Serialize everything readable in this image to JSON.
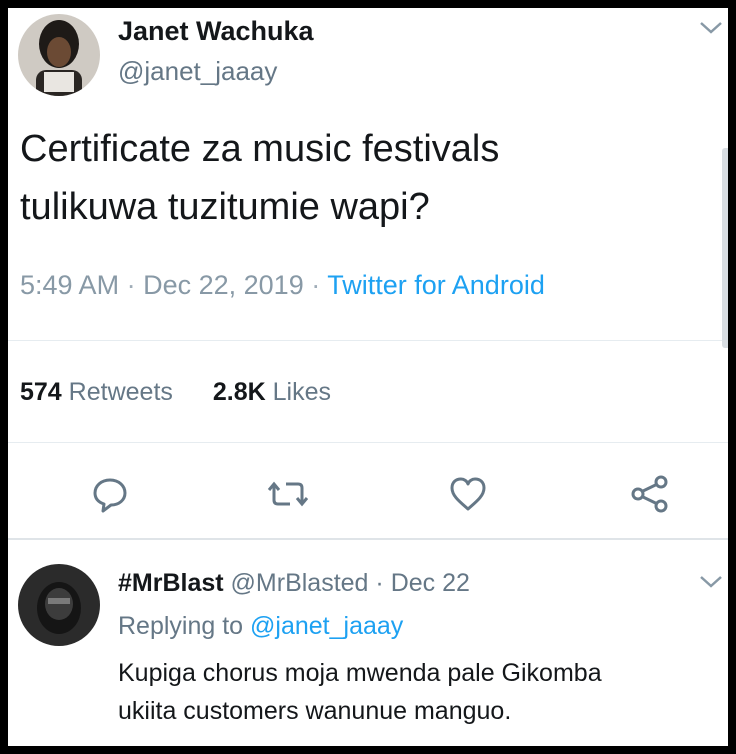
{
  "tweet": {
    "author_name": "Janet Wachuka",
    "author_handle": "@janet_jaaay",
    "text": "Certificate za music festivals\ntulikuwa tuzitumie wapi?",
    "time": "5:49 AM",
    "date": "Dec 22, 2019",
    "separator": "·",
    "source": "Twitter for Android",
    "retweets_count": "574",
    "retweets_label": "Retweets",
    "likes_count": "2.8K",
    "likes_label": "Likes"
  },
  "actions": {
    "reply_icon": "comment-icon",
    "retweet_icon": "retweet-icon",
    "like_icon": "heart-icon",
    "share_icon": "share-icon"
  },
  "reply": {
    "author_name": "#MrBlast",
    "author_handle": "@MrBlasted",
    "separator": "·",
    "date": "Dec 22",
    "replying_prefix": "Replying to",
    "replying_to": "@janet_jaaay",
    "text": "Kupiga chorus moja mwenda pale Gikomba\nukiita customers wanunue manguo."
  },
  "colors": {
    "text": "#14171a",
    "secondary": "#657786",
    "link": "#1da1f2",
    "divider": "#e6ecf0"
  }
}
